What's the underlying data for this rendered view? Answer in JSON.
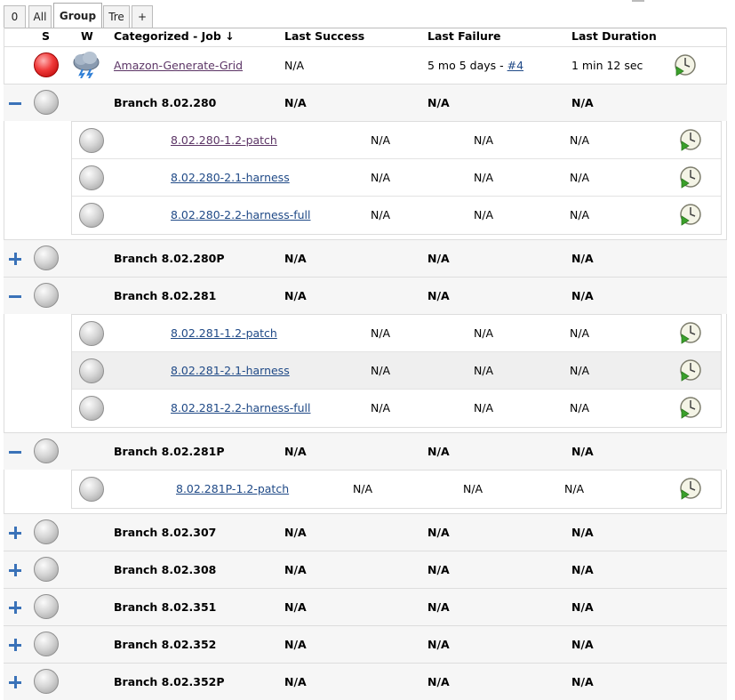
{
  "tabs": [
    "0",
    "All",
    "Group",
    "Tre",
    "+"
  ],
  "columns": {
    "status": "S",
    "weather": "W",
    "job": "Categorized - Job",
    "sort_arrow": "↓",
    "last_success": "Last Success",
    "last_failure": "Last Failure",
    "last_duration": "Last Duration"
  },
  "top_job": {
    "name": "Amazon-Generate-Grid",
    "last_success": "N/A",
    "last_failure_prefix": "5 mo 5 days - ",
    "last_failure_link": "#4",
    "last_duration": "1 min 12 sec",
    "status_icon": "red-ball-icon",
    "weather_icon": "thunderstorm-icon"
  },
  "groups": [
    {
      "name": "Branch 8.02.280",
      "expanded": true,
      "last_success": "N/A",
      "last_failure": "N/A",
      "last_duration": "N/A",
      "jobs": [
        {
          "name": "8.02.280-1.2-patch",
          "last_success": "N/A",
          "last_failure": "N/A",
          "last_duration": "N/A",
          "visited": true
        },
        {
          "name": "8.02.280-2.1-harness",
          "last_success": "N/A",
          "last_failure": "N/A",
          "last_duration": "N/A"
        },
        {
          "name": "8.02.280-2.2-harness-full",
          "last_success": "N/A",
          "last_failure": "N/A",
          "last_duration": "N/A"
        }
      ]
    },
    {
      "name": "Branch 8.02.280P",
      "expanded": false,
      "last_success": "N/A",
      "last_failure": "N/A",
      "last_duration": "N/A"
    },
    {
      "name": "Branch 8.02.281",
      "expanded": true,
      "last_success": "N/A",
      "last_failure": "N/A",
      "last_duration": "N/A",
      "jobs": [
        {
          "name": "8.02.281-1.2-patch",
          "last_success": "N/A",
          "last_failure": "N/A",
          "last_duration": "N/A"
        },
        {
          "name": "8.02.281-2.1-harness",
          "last_success": "N/A",
          "last_failure": "N/A",
          "last_duration": "N/A",
          "highlighted": true
        },
        {
          "name": "8.02.281-2.2-harness-full",
          "last_success": "N/A",
          "last_failure": "N/A",
          "last_duration": "N/A"
        }
      ]
    },
    {
      "name": "Branch 8.02.281P",
      "expanded": true,
      "last_success": "N/A",
      "last_failure": "N/A",
      "last_duration": "N/A",
      "jobs": [
        {
          "name": "8.02.281P-1.2-patch",
          "last_success": "N/A",
          "last_failure": "N/A",
          "last_duration": "N/A"
        }
      ]
    },
    {
      "name": "Branch 8.02.307",
      "expanded": false,
      "last_success": "N/A",
      "last_failure": "N/A",
      "last_duration": "N/A"
    },
    {
      "name": "Branch 8.02.308",
      "expanded": false,
      "last_success": "N/A",
      "last_failure": "N/A",
      "last_duration": "N/A"
    },
    {
      "name": "Branch 8.02.351",
      "expanded": false,
      "last_success": "N/A",
      "last_failure": "N/A",
      "last_duration": "N/A"
    },
    {
      "name": "Branch 8.02.352",
      "expanded": false,
      "last_success": "N/A",
      "last_failure": "N/A",
      "last_duration": "N/A"
    },
    {
      "name": "Branch 8.02.352P",
      "expanded": false,
      "last_success": "N/A",
      "last_failure": "N/A",
      "last_duration": "N/A"
    }
  ],
  "icons": {
    "status_not_built": "grey-ball-icon",
    "schedule": "schedule-build-icon",
    "expand": "expand-plus-icon",
    "collapse": "collapse-minus-icon"
  },
  "colors": {
    "link": "#204a87",
    "visited_link": "#5c3566",
    "group_row_bg": "#f6f6f6",
    "failure_red": "#f03a3a"
  }
}
